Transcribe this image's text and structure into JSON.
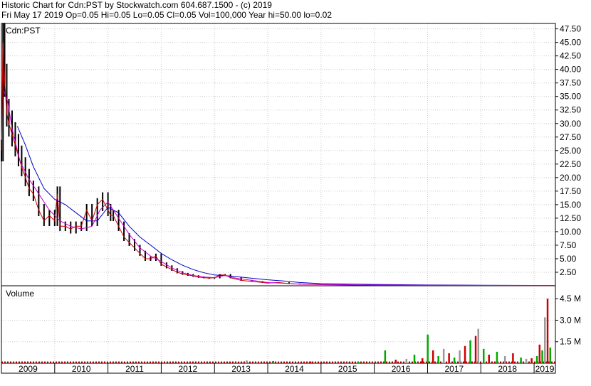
{
  "header": {
    "line1": "Historic Chart for Cdn:PST by Stockwatch.com 604.687.1500 - (c) 2019",
    "line2": "Fri May 17 2019  Op=0.05  Hi=0.05  Lo=0.05  Cl=0.05  Vol=100,000  Year hi=50.00  lo=0.02"
  },
  "colors": {
    "price_bar": "#000000",
    "ma_short": "#cc00cc",
    "ma_long": "#0000cc",
    "close_line": "#cc0000",
    "vol_up": "#00aa00",
    "vol_down": "#cc0000",
    "vol_flat": "#999999",
    "grid": "#cccccc"
  },
  "chart_data": [
    {
      "type": "line",
      "title": "Cdn:PST",
      "ylim": [
        0,
        48.5
      ],
      "y_ticks": [
        "47.50",
        "45.00",
        "42.50",
        "40.00",
        "37.50",
        "35.00",
        "32.50",
        "30.00",
        "27.50",
        "25.00",
        "22.50",
        "20.00",
        "17.50",
        "15.00",
        "12.50",
        "10.00",
        "7.50",
        "5.00",
        "2.50"
      ],
      "y_tick_values": [
        47.5,
        45,
        42.5,
        40,
        37.5,
        35,
        32.5,
        30,
        27.5,
        25,
        22.5,
        20,
        17.5,
        15,
        12.5,
        10,
        7.5,
        5,
        2.5
      ],
      "xlim": [
        2009.0,
        2019.4
      ],
      "x_ticks": [
        "2009",
        "2010",
        "2011",
        "2012",
        "2013",
        "2014",
        "2015",
        "2016",
        "2017",
        "2018",
        "2019"
      ],
      "x_tick_values": [
        2009.0,
        2010.0,
        2011.0,
        2012.0,
        2013.0,
        2014.0,
        2015.0,
        2016.0,
        2017.0,
        2018.0,
        2019.0
      ],
      "grid": true,
      "series_price": {
        "x": [
          2009.0,
          2009.03,
          2009.06,
          2009.1,
          2009.14,
          2009.2,
          2009.26,
          2009.32,
          2009.38,
          2009.45,
          2009.52,
          2009.6,
          2009.7,
          2009.8,
          2009.9,
          2010.0,
          2010.05,
          2010.1,
          2010.2,
          2010.3,
          2010.4,
          2010.5,
          2010.6,
          2010.7,
          2010.8,
          2010.9,
          2011.0,
          2011.05,
          2011.1,
          2011.2,
          2011.3,
          2011.4,
          2011.5,
          2011.6,
          2011.7,
          2011.8,
          2011.9,
          2012.0,
          2012.1,
          2012.2,
          2012.3,
          2012.4,
          2012.5,
          2012.6,
          2012.7,
          2012.8,
          2012.9,
          2013.0,
          2013.1,
          2013.2,
          2013.3,
          2013.5,
          2013.7,
          2013.9,
          2014.0,
          2014.2,
          2014.4,
          2014.6,
          2014.8,
          2015.0,
          2015.5,
          2016.0,
          2016.5,
          2017.0,
          2017.5,
          2018.0,
          2018.5,
          2019.0,
          2019.38
        ],
        "values": [
          25,
          45,
          38,
          32,
          30,
          28,
          26,
          24,
          22,
          20,
          18,
          17,
          14,
          12,
          13,
          12,
          17,
          11,
          11,
          10.5,
          11,
          11,
          14,
          12,
          15,
          16,
          14,
          13,
          13,
          11,
          9,
          8,
          7,
          6,
          5,
          5,
          5.5,
          4,
          3.5,
          3,
          2.5,
          2.2,
          2,
          1.8,
          1.6,
          1.5,
          1.4,
          1.5,
          2,
          2,
          1.5,
          1.0,
          0.8,
          0.6,
          0.5,
          0.6,
          0.4,
          0.3,
          0.25,
          0.2,
          0.15,
          0.1,
          0.1,
          0.08,
          0.08,
          0.06,
          0.05,
          0.05,
          0.05
        ]
      },
      "series_ma_short": {
        "x": [
          2009.05,
          2009.12,
          2009.2,
          2009.35,
          2009.5,
          2009.7,
          2009.9,
          2010.1,
          2010.3,
          2010.5,
          2010.7,
          2010.85,
          2011.0,
          2011.2,
          2011.4,
          2011.6,
          2011.8,
          2012.0,
          2012.2,
          2012.4,
          2012.6,
          2012.8,
          2013.0,
          2013.2,
          2013.4,
          2013.7,
          2014.0,
          2014.5,
          2015.0,
          2016.0,
          2017.0,
          2018.0,
          2019.0,
          2019.38
        ],
        "values": [
          36,
          34,
          29,
          23,
          20,
          17,
          14,
          12,
          11,
          10.5,
          11,
          14,
          15.5,
          12.5,
          9.5,
          7,
          5.5,
          4.5,
          3.3,
          2.4,
          1.9,
          1.6,
          1.5,
          1.9,
          1.4,
          1.0,
          0.6,
          0.35,
          0.22,
          0.13,
          0.09,
          0.07,
          0.05,
          0.05
        ]
      },
      "series_ma_long": {
        "x": [
          2009.3,
          2009.45,
          2009.6,
          2009.8,
          2010.0,
          2010.2,
          2010.4,
          2010.6,
          2010.8,
          2011.0,
          2011.2,
          2011.4,
          2011.6,
          2011.8,
          2012.0,
          2012.2,
          2012.4,
          2012.6,
          2012.8,
          2013.0,
          2013.3,
          2013.6,
          2014.0,
          2014.3,
          2014.6,
          2015.0,
          2016.0,
          2017.0,
          2018.0,
          2019.0,
          2019.38
        ],
        "values": [
          29.5,
          26,
          22,
          18,
          16,
          15,
          13.5,
          12,
          12,
          14.5,
          13.5,
          11,
          9,
          7.5,
          6,
          4.8,
          3.8,
          3.0,
          2.4,
          2.0,
          1.8,
          1.5,
          1.1,
          0.9,
          0.6,
          0.4,
          0.25,
          0.15,
          0.1,
          0.07,
          0.06
        ]
      }
    },
    {
      "type": "bar",
      "title": "Volume",
      "ylim": [
        0,
        5400000
      ],
      "y_ticks": [
        "4.5 M",
        "3.0 M",
        "1.5 M"
      ],
      "y_tick_values": [
        4500000,
        3000000,
        1500000
      ],
      "x": [
        2013.6,
        2014.1,
        2014.8,
        2015.5,
        2015.7,
        2016.2,
        2016.4,
        2016.6,
        2016.75,
        2016.9,
        2017.0,
        2017.1,
        2017.2,
        2017.3,
        2017.4,
        2017.5,
        2017.6,
        2017.7,
        2017.8,
        2017.9,
        2017.95,
        2018.05,
        2018.15,
        2018.3,
        2018.45,
        2018.6,
        2018.75,
        2018.85,
        2018.95,
        2019.05,
        2019.1,
        2019.15,
        2019.2,
        2019.25,
        2019.3
      ],
      "values": [
        200000,
        150000,
        120000,
        100000,
        100000,
        900000,
        250000,
        300000,
        600000,
        350000,
        2000000,
        900000,
        500000,
        1000000,
        700000,
        400000,
        900000,
        1200000,
        1600000,
        1900000,
        2400000,
        1000000,
        600000,
        800000,
        500000,
        700000,
        400000,
        300000,
        350000,
        500000,
        1300000,
        900000,
        3200000,
        4500000,
        1100000
      ],
      "directions": [
        "flat",
        "up",
        "down",
        "flat",
        "up",
        "up",
        "down",
        "flat",
        "up",
        "down",
        "up",
        "down",
        "up",
        "flat",
        "down",
        "up",
        "flat",
        "down",
        "up",
        "down",
        "flat",
        "up",
        "down",
        "up",
        "flat",
        "down",
        "up",
        "flat",
        "down",
        "up",
        "down",
        "up",
        "flat",
        "down",
        "up"
      ]
    }
  ]
}
